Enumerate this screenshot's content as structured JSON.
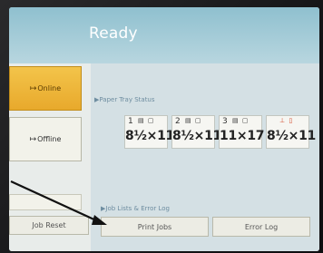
{
  "screen": {
    "title": "Ready"
  },
  "modes": {
    "online_label": "Online",
    "offline_label": "Offline",
    "arrow_glyph": "↦"
  },
  "paper_tray": {
    "section_label": "▶Paper Tray Status",
    "trays": [
      {
        "number": "1",
        "icons": "▤ ▢",
        "size": "8½×11"
      },
      {
        "number": "2",
        "icons": "▤ ▢",
        "size": "8½×11"
      },
      {
        "number": "3",
        "icons": "▤ ▢",
        "size": "11×17"
      },
      {
        "number": "",
        "icons": "⊥ ▯",
        "size": "8½×11"
      }
    ]
  },
  "job_lists": {
    "section_label": "▶Job Lists & Error Log",
    "print_jobs_label": "Print Jobs",
    "error_log_label": "Error Log"
  },
  "buttons": {
    "job_reset_label": "Job Reset"
  }
}
